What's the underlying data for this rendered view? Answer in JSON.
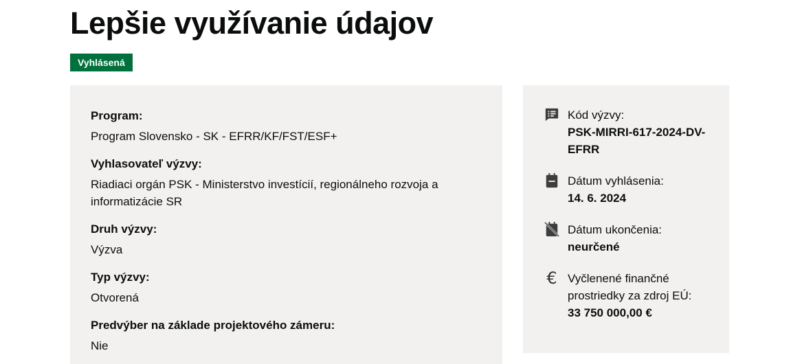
{
  "header": {
    "title": "Lepšie využívanie údajov",
    "status_badge": "Vyhlásená"
  },
  "details": {
    "program_label": "Program:",
    "program_value": "Program Slovensko - SK - EFRR/KF/FST/ESF+",
    "announcer_label": "Vyhlasovateľ výzvy:",
    "announcer_value": "Riadiaci orgán PSK - Ministerstvo investícií, regionálneho rozvoja a informatizácie SR",
    "call_kind_label": "Druh výzvy:",
    "call_kind_value": "Výzva",
    "call_type_label": "Typ výzvy:",
    "call_type_value": "Otvorená",
    "preselection_label": "Predvýber na základe projektového zámeru:",
    "preselection_value": "Nie"
  },
  "sidebar": {
    "code_label": "Kód výzvy:",
    "code_value": "PSK-MIRRI-617-2024-DV-EFRR",
    "announce_date_label": "Dátum vyhlásenia:",
    "announce_date_value": "14. 6. 2024",
    "end_date_label": "Dátum ukončenia:",
    "end_date_value": "neurčené",
    "funds_label": "Vyčlenené finančné prostriedky za zdroj EÚ:",
    "funds_value": "33 750 000,00 €",
    "icons": {
      "code": "message-list-icon",
      "announce_date": "calendar-icon",
      "end_date": "calendar-off-icon",
      "funds": "euro-icon"
    }
  },
  "colors": {
    "badge_bg": "#00703c",
    "panel_bg": "#f2f1f0",
    "text": "#0b0c0c"
  }
}
